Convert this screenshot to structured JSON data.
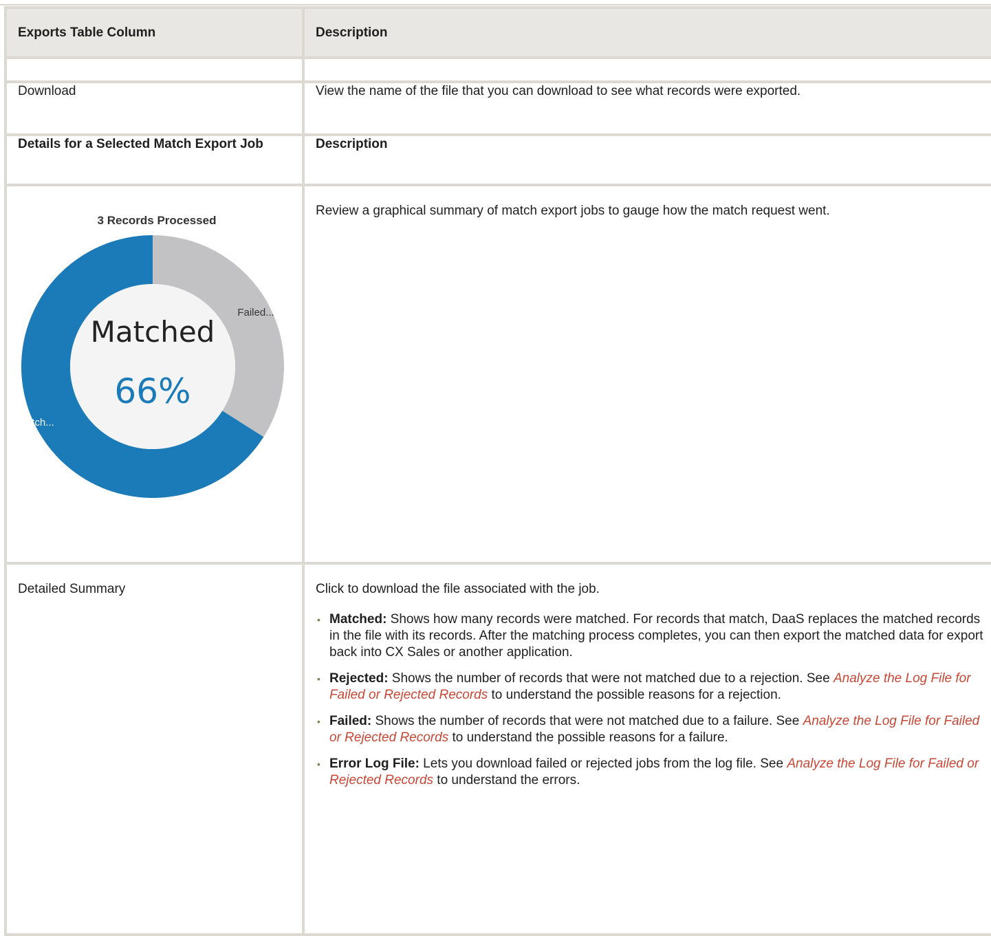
{
  "table": {
    "header": {
      "col1": "Exports Table Column",
      "col2": "Description"
    },
    "download_row": {
      "col1": "Download",
      "col2": "View the name of the file that you can download to see what records were exported."
    },
    "details_header": {
      "col1": "Details for a Selected Match Export Job",
      "col2": "Description"
    },
    "chart_row": {
      "col2": "Review a graphical summary of match export jobs to gauge how the match request went."
    },
    "summary_row": {
      "col1": "Detailed Summary",
      "intro": "Click to download the file associated with the job.",
      "bullets": [
        {
          "term": "Matched:",
          "text": " Shows how many records were matched. For records that match, DaaS replaces the matched records in the file with its records. After the matching process completes, you can then export the matched data for export back into CX Sales or another application."
        },
        {
          "term": "Rejected:",
          "text_before": " Shows the number of records that were not matched due to a rejection. See ",
          "link": "Analyze the Log File for Failed or Rejected Records",
          "text_after": " to understand the possible reasons for a rejection."
        },
        {
          "term": "Failed:",
          "text_before": " Shows the number of records that were not matched due to a failure. See ",
          "link": "Analyze the Log File for Failed or Rejected Records",
          "text_after": " to understand the possible reasons for a failure."
        },
        {
          "term": "Error Log File:",
          "text_before": " Lets you download failed or rejected jobs from the log file. See ",
          "link": "Analyze the Log File for Failed or Rejected Records",
          "text_after": " to understand the errors."
        }
      ]
    }
  },
  "chart_data": {
    "type": "pie",
    "title": "3 Records Processed",
    "center_label": "Matched",
    "center_value": "66%",
    "slices": [
      {
        "label": "Match...",
        "value": 66,
        "color": "#1b7bb8"
      },
      {
        "label": "Failed...",
        "value": 34,
        "color": "#c2c2c4"
      }
    ]
  }
}
